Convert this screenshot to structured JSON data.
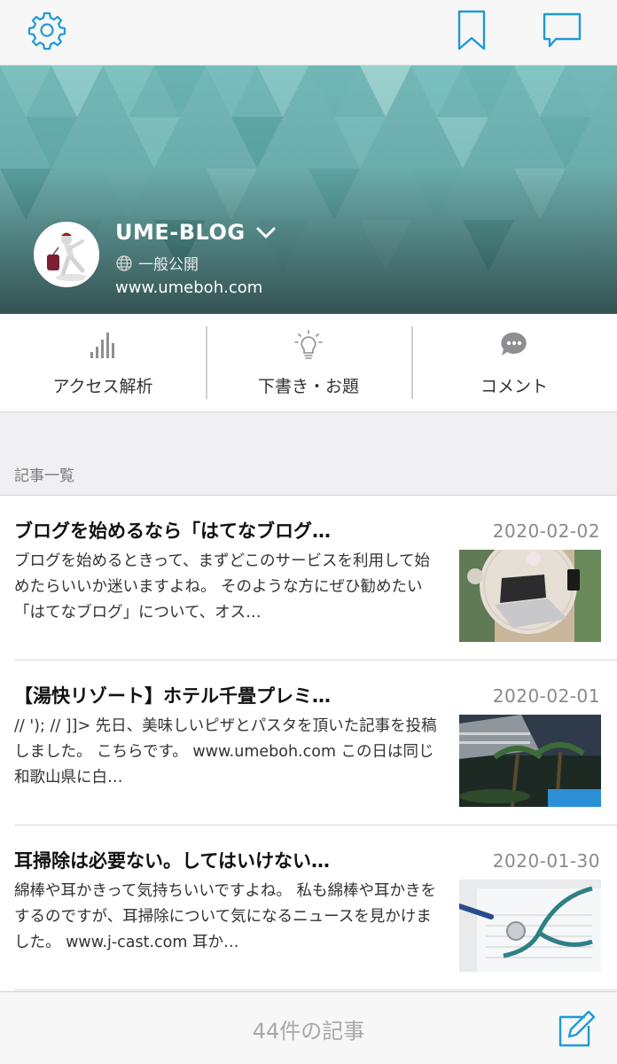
{
  "colors": {
    "accent": "#1e9ad6",
    "banner": "#6fb5b4",
    "icon_gray": "#8e8e93"
  },
  "topbar": {
    "settings_icon": "gear-icon",
    "bookmark_icon": "bookmark-icon",
    "comment_icon": "speech-bubble-icon"
  },
  "blog": {
    "title": "UME-BLOG",
    "visibility": "一般公開",
    "url": "www.umeboh.com"
  },
  "actions": [
    {
      "label": "アクセス解析",
      "icon": "bar-chart-icon"
    },
    {
      "label": "下書き・お題",
      "icon": "lightbulb-icon"
    },
    {
      "label": "コメント",
      "icon": "comment-bubble-icon"
    }
  ],
  "section_label": "記事一覧",
  "articles": [
    {
      "title": "ブログを始めるなら「はてなブログ…",
      "date": "2020-02-02",
      "excerpt": "ブログを始めるときって、まずどこのサービスを利用して始めたらいいか迷いますよね。 そのような方にぜひ勧めたい「はてなブログ」について、オス…"
    },
    {
      "title": "【湯快リゾート】ホテル千畳プレミ…",
      "date": "2020-02-01",
      "excerpt": "// '); // ]]> 先日、美味しいピザとパスタを頂いた記事を投稿しました。 こちらです。 www.umeboh.com この日は同じ和歌山県に白…"
    },
    {
      "title": "耳掃除は必要ない。してはいけない…",
      "date": "2020-01-30",
      "excerpt": "綿棒や耳かきって気持ちいいですよね。 私も綿棒や耳かきをするのですが、耳掃除について気になるニュースを見かけました。 www.j-cast.com 耳か…"
    }
  ],
  "footer": {
    "count": "44件の記事",
    "compose_icon": "compose-icon"
  }
}
